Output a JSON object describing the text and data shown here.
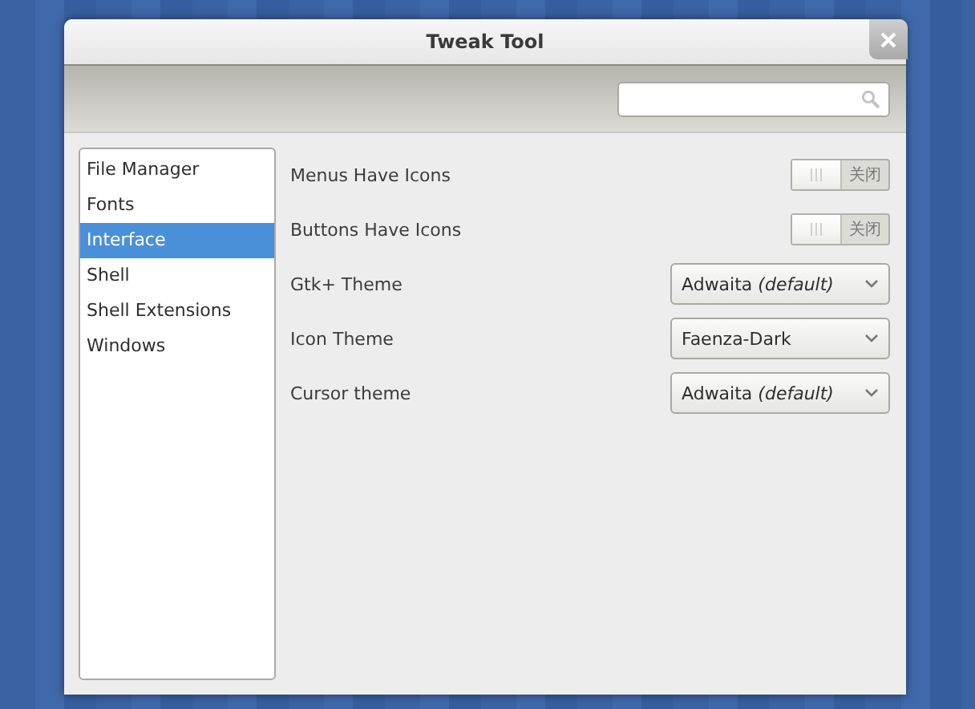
{
  "window": {
    "title": "Tweak Tool"
  },
  "sidebar": {
    "items": [
      {
        "label": "File Manager",
        "selected": false
      },
      {
        "label": "Fonts",
        "selected": false
      },
      {
        "label": "Interface",
        "selected": true
      },
      {
        "label": "Shell",
        "selected": false
      },
      {
        "label": "Shell Extensions",
        "selected": false
      },
      {
        "label": "Windows",
        "selected": false
      }
    ]
  },
  "settings": [
    {
      "kind": "switch",
      "label": "Menus Have Icons",
      "on": false,
      "state_text": "关闭"
    },
    {
      "kind": "switch",
      "label": "Buttons Have Icons",
      "on": false,
      "state_text": "关闭"
    },
    {
      "kind": "combo",
      "label": "Gtk+ Theme",
      "value": "Adwaita *(default)*"
    },
    {
      "kind": "combo",
      "label": "Icon Theme",
      "value": "Faenza-Dark"
    },
    {
      "kind": "combo",
      "label": "Cursor theme",
      "value": "Adwaita *(default)*"
    }
  ]
}
